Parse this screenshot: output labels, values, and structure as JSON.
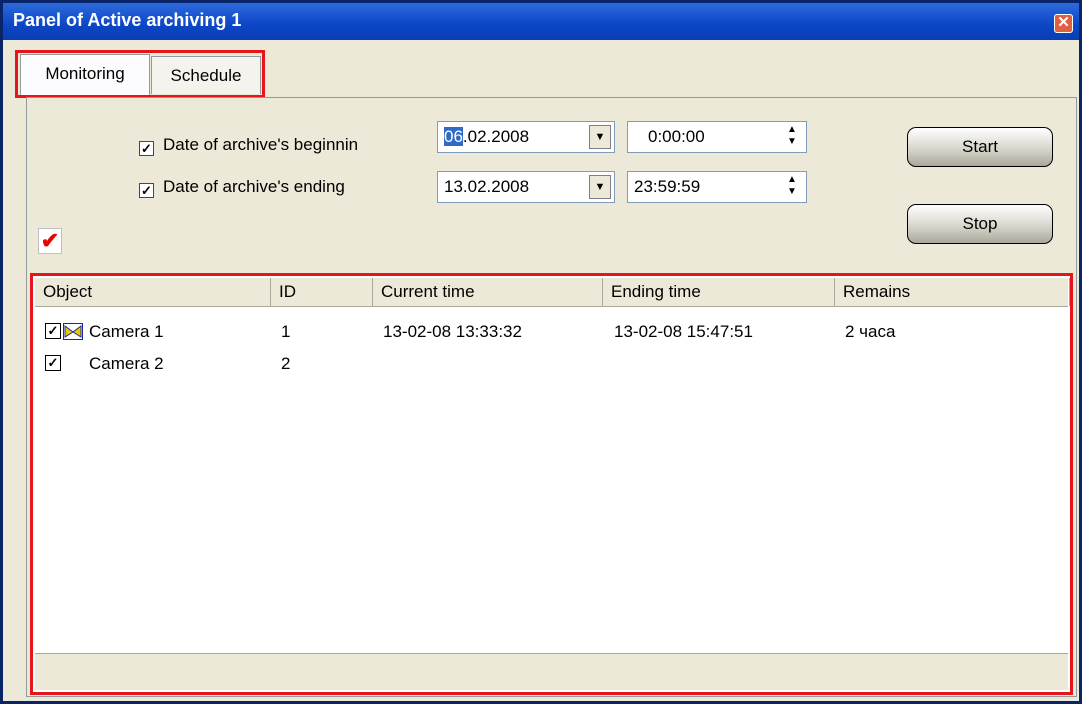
{
  "window": {
    "title": "Panel of Active archiving 1",
    "close_icon": "close-icon"
  },
  "tabs": [
    {
      "label": "Monitoring"
    },
    {
      "label": "Schedule"
    }
  ],
  "filters": {
    "begin": {
      "checked": true,
      "label": "Date of archive's beginnin",
      "date_highlight": "06",
      "date_rest": ".02.2008",
      "time": "0:00:00"
    },
    "end": {
      "checked": true,
      "label": "Date of archive's ending",
      "date": "13.02.2008",
      "time": "23:59:59"
    }
  },
  "buttons": {
    "start": "Start",
    "stop": "Stop"
  },
  "apply_icon": "red-checkmark-icon",
  "table": {
    "columns": [
      "Object",
      "ID",
      "Current time",
      "Ending time",
      "Remains"
    ],
    "rows": [
      {
        "checked": true,
        "has_icon": true,
        "object": "Camera 1",
        "id": "1",
        "current_time": "13-02-08 13:33:32",
        "ending_time": "13-02-08 15:47:51",
        "remains": "2 часа"
      },
      {
        "checked": true,
        "has_icon": false,
        "object": "Camera 2",
        "id": "2",
        "current_time": "",
        "ending_time": "",
        "remains": ""
      }
    ]
  },
  "colors": {
    "highlight_border": "#e8141c",
    "titlebar": "#0b46c6",
    "selection": "#316ac5"
  }
}
